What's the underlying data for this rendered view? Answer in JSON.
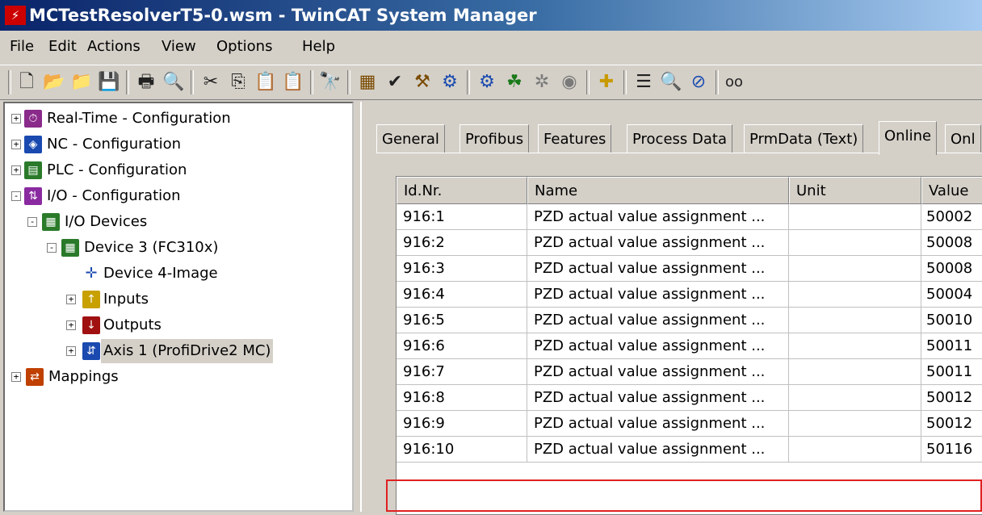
{
  "window": {
    "title": "MCTestResolverT5-0.wsm - TwinCAT System Manager"
  },
  "menu": [
    "File",
    "Edit",
    "Actions",
    "View",
    "Options",
    "Help"
  ],
  "toolbar": {
    "buttons": [
      "new-icon",
      "open-icon",
      "open-folder-icon",
      "save-icon",
      "print-icon",
      "print-preview-icon",
      "cut-icon",
      "copy-icon",
      "paste-icon",
      "paste-with-links-icon",
      "find-icon",
      "generate-mappings-icon",
      "check-configuration-icon",
      "activate-configuration-icon",
      "set-run-mode-icon",
      "set-config-mode-icon",
      "scan-devices-icon",
      "toggle-free-run-icon",
      "restart-icon",
      "append-item-icon",
      "properties-icon",
      "zoom-icon",
      "show-online-data-icon",
      "binoculars-icon"
    ]
  },
  "tree": {
    "items": [
      {
        "label": "Real-Time - Configuration",
        "icon": "realtime-icon",
        "expander": "+"
      },
      {
        "label": "NC - Configuration",
        "icon": "nc-icon",
        "expander": "+"
      },
      {
        "label": "PLC - Configuration",
        "icon": "plc-icon",
        "expander": "+"
      },
      {
        "label": "I/O - Configuration",
        "icon": "io-icon",
        "expander": "-"
      },
      {
        "label": "I/O Devices",
        "icon": "io-devices-icon",
        "expander": "-"
      },
      {
        "label": "Device 3 (FC310x)",
        "icon": "device-card-icon",
        "expander": "-"
      },
      {
        "label": "Device 4-Image",
        "icon": "process-image-icon",
        "expander": ""
      },
      {
        "label": "Inputs",
        "icon": "inputs-icon",
        "expander": "+"
      },
      {
        "label": "Outputs",
        "icon": "outputs-icon",
        "expander": "+"
      },
      {
        "label": "Axis 1 (ProfiDrive2 MC)",
        "icon": "axis-icon",
        "expander": "+",
        "selected": true
      },
      {
        "label": "Mappings",
        "icon": "mappings-icon",
        "expander": "+"
      }
    ]
  },
  "tabs": [
    "General",
    "Profibus",
    "Features",
    "Process Data",
    "PrmData (Text)",
    "Online",
    "Onl"
  ],
  "active_tab": "Online",
  "table": {
    "columns": [
      "Id.Nr.",
      "Name",
      "Unit",
      "Value"
    ],
    "rows": [
      [
        "916:1",
        "PZD actual value assignment ...",
        "",
        "50002"
      ],
      [
        "916:2",
        "PZD actual value assignment ...",
        "",
        "50008"
      ],
      [
        "916:3",
        "PZD actual value assignment ...",
        "",
        "50008"
      ],
      [
        "916:4",
        "PZD actual value assignment ...",
        "",
        "50004"
      ],
      [
        "916:5",
        "PZD actual value assignment ...",
        "",
        "50010"
      ],
      [
        "916:6",
        "PZD actual value assignment ...",
        "",
        "50011"
      ],
      [
        "916:7",
        "PZD actual value assignment ...",
        "",
        "50011"
      ],
      [
        "916:8",
        "PZD actual value assignment ...",
        "",
        "50012"
      ],
      [
        "916:9",
        "PZD actual value assignment ...",
        "",
        "50012"
      ],
      [
        "916:10",
        "PZD actual value assignment ...",
        "",
        "50116"
      ]
    ],
    "highlighted_row": 9,
    "highlight_color": "#e02020"
  }
}
